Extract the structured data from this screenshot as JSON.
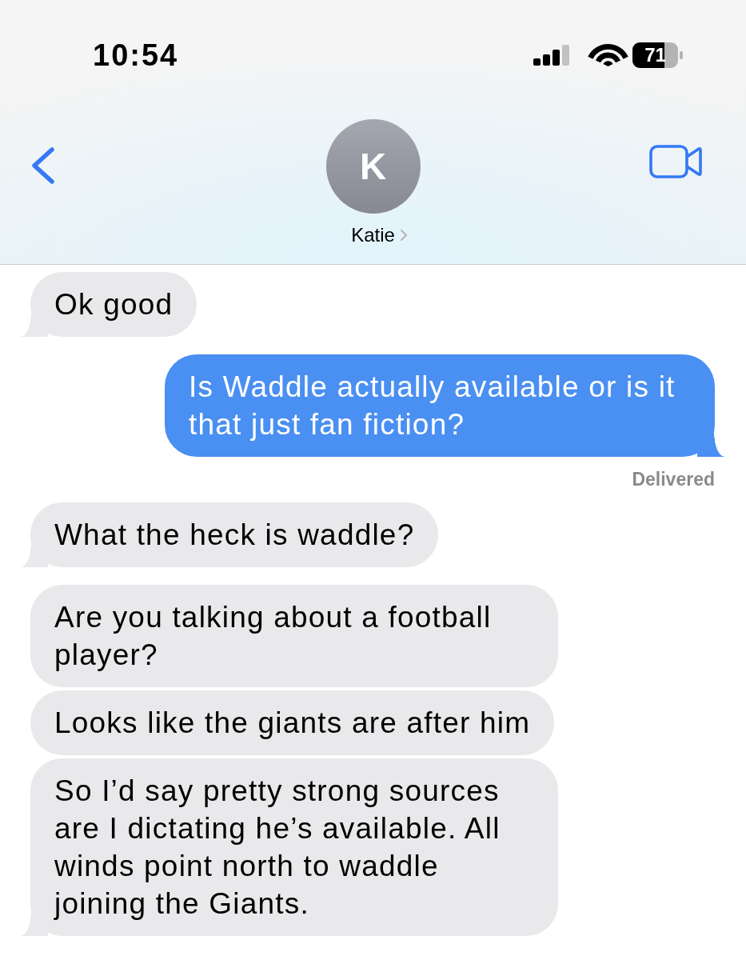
{
  "status_bar": {
    "time": "10:54",
    "battery": "71"
  },
  "header": {
    "avatar_initial": "K",
    "contact_name": "Katie"
  },
  "messages": [
    {
      "kind": "received",
      "text": "Ok good",
      "tail": true
    },
    {
      "kind": "sent",
      "text": "Is Waddle actually available or is it that just fan fiction?",
      "tail": true,
      "status": "Delivered"
    },
    {
      "kind": "received",
      "text": "What the heck is waddle?",
      "tail": true
    },
    {
      "kind": "received",
      "text": "Are you talking about a football player?",
      "tail": false
    },
    {
      "kind": "received",
      "text": "Looks like the giants are after him",
      "tail": false
    },
    {
      "kind": "received",
      "text": "So I’d say pretty strong sources are I dictating he’s available. All winds point north to waddle joining the Giants.",
      "tail": true
    }
  ]
}
